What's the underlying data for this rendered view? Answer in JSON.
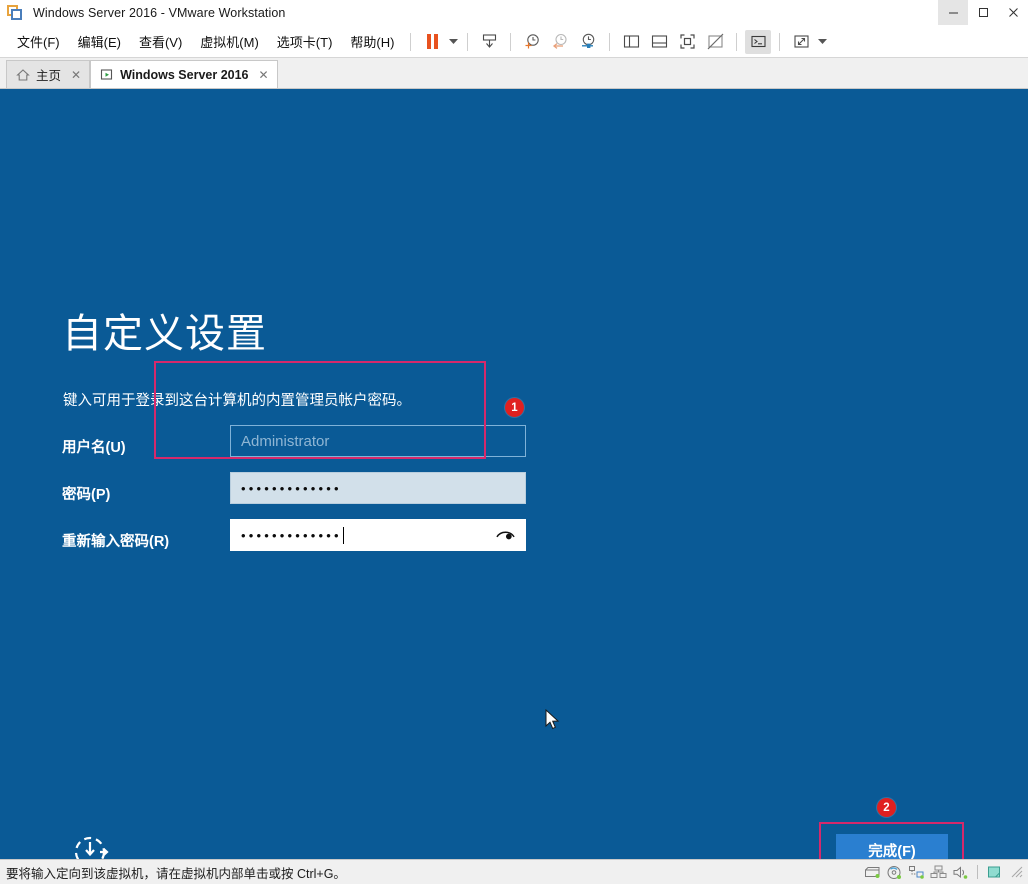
{
  "window": {
    "title": "Windows Server 2016 - VMware Workstation",
    "logo_icon": "vmware-logo-icon",
    "minimize_label": "–",
    "maximize_label": "☐",
    "close_label": "✕"
  },
  "menubar": {
    "items": [
      {
        "label": "文件(F)",
        "name": "menu-file"
      },
      {
        "label": "编辑(E)",
        "name": "menu-edit"
      },
      {
        "label": "查看(V)",
        "name": "menu-view"
      },
      {
        "label": "虚拟机(M)",
        "name": "menu-vm"
      },
      {
        "label": "选项卡(T)",
        "name": "menu-tabs"
      },
      {
        "label": "帮助(H)",
        "name": "menu-help"
      }
    ],
    "toolbar": [
      {
        "name": "pause-vm-button",
        "icon": "pause-icon"
      },
      {
        "name": "power-dropdown-caret",
        "icon": "chevron-down-icon"
      },
      {
        "name": "snapshot-manager-button",
        "icon": "snapshot-icon"
      },
      {
        "name": "take-snapshot-button",
        "icon": "clock-plus-icon"
      },
      {
        "name": "revert-snapshot-button",
        "icon": "clock-back-icon"
      },
      {
        "name": "manage-snapshots-button",
        "icon": "clock-gear-icon"
      },
      {
        "name": "show-library-button",
        "icon": "panel-left-icon"
      },
      {
        "name": "show-thumbnail-bar-button",
        "icon": "panel-bottom-icon"
      },
      {
        "name": "fullscreen-button",
        "icon": "fullscreen-icon"
      },
      {
        "name": "unity-mode-button",
        "icon": "unity-off-icon"
      },
      {
        "name": "console-button",
        "icon": "terminal-icon"
      },
      {
        "name": "stretch-guest-button",
        "icon": "expand-arrows-icon"
      },
      {
        "name": "stretch-dropdown-caret",
        "icon": "chevron-down-icon"
      }
    ]
  },
  "tabs": [
    {
      "label": "主页",
      "icon": "home-icon",
      "close": "✕",
      "active": false
    },
    {
      "label": "Windows Server 2016",
      "icon": "vm-running-icon",
      "close": "✕",
      "active": true
    }
  ],
  "guest": {
    "heading": "自定义设置",
    "subtitle": "键入可用于登录到这台计算机的内置管理员帐户密码。",
    "fields": [
      {
        "label": "用户名(U)",
        "name": "username-field",
        "type": "text",
        "value": "",
        "placeholder": "Administrator"
      },
      {
        "label": "密码(P)",
        "name": "password-field",
        "type": "password",
        "value": "•••••••••••••",
        "placeholder": ""
      },
      {
        "label": "重新输入密码(R)",
        "name": "confirm-password-field",
        "type": "password",
        "value": "•••••••••••••",
        "placeholder": "",
        "reveal_icon": "eye-icon"
      }
    ],
    "finish_button": "完成(F)",
    "ease_of_access_icon": "ease-of-access-icon",
    "cursor_icon": "mouse-pointer-icon"
  },
  "annotations": [
    {
      "badge": "1",
      "name": "annotation-badge-1",
      "target": "password-fields"
    },
    {
      "badge": "2",
      "name": "annotation-badge-2",
      "target": "finish-button"
    }
  ],
  "statusbar": {
    "message": "要将输入定向到该虚拟机，请在虚拟机内部单击或按 Ctrl+G。",
    "icons": [
      {
        "name": "hard-disk-icon"
      },
      {
        "name": "cd-dvd-icon"
      },
      {
        "name": "network-adapter-icon"
      },
      {
        "name": "usb-device-icon"
      },
      {
        "name": "sound-card-icon"
      },
      {
        "name": "printer-icon"
      }
    ],
    "resize_grip": "resize-grip-icon"
  },
  "colors": {
    "guest_background": "#0a5a96",
    "accent_red": "#e02020",
    "annotation_pink": "#d6296b",
    "button_blue": "#2a7fd0"
  }
}
